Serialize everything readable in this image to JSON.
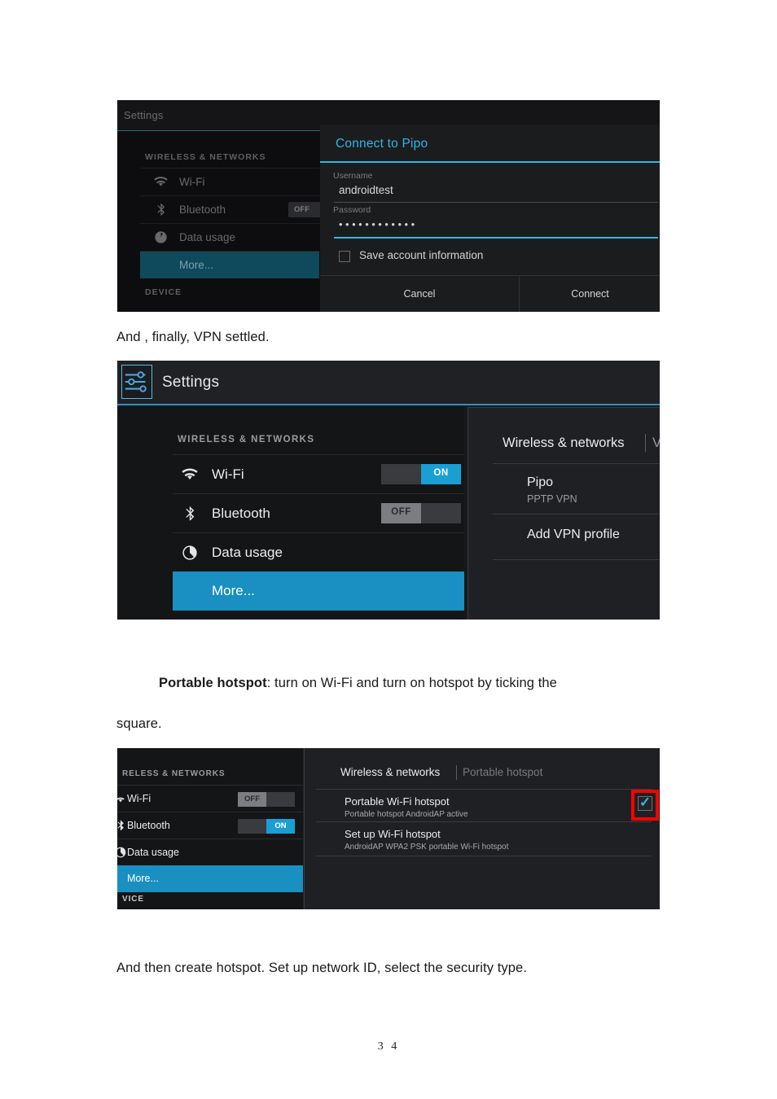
{
  "document": {
    "paragraphs": [
      {
        "id": "p1",
        "text": "And , finally, VPN settled."
      },
      {
        "id": "p2_bold",
        "text": "Portable hotspot"
      },
      {
        "id": "p2_rest",
        "text": ": turn on Wi-Fi and turn on hotspot by ticking the"
      },
      {
        "id": "p2_line2",
        "text": "square."
      },
      {
        "id": "p3",
        "text": "And then create hotspot. Set up network ID, select the security type."
      }
    ],
    "page_number": "3 4"
  },
  "shot1": {
    "title": "Settings",
    "section_label": "WIRELESS & NETWORKS",
    "rows": [
      {
        "label": "Wi-Fi",
        "icon": "wifi-icon",
        "toggle": ""
      },
      {
        "label": "Bluetooth",
        "icon": "bluetooth-icon",
        "toggle": "OFF"
      },
      {
        "label": "Data usage",
        "icon": "data-usage-icon",
        "toggle": ""
      },
      {
        "label": "More...",
        "icon": "",
        "toggle": ""
      }
    ],
    "device_label": "DEVICE",
    "dialog": {
      "title": "Connect to Pipo",
      "username_label": "Username",
      "username_value": "androidtest",
      "password_label": "Password",
      "password_value": "••••••••••••",
      "save_checkbox_label": "Save account information",
      "cancel_label": "Cancel",
      "connect_label": "Connect"
    }
  },
  "shot2": {
    "app_icon": "settings-sliders-icon",
    "title": "Settings",
    "section_label": "WIRELESS & NETWORKS",
    "rows": [
      {
        "label": "Wi-Fi",
        "icon": "wifi-icon",
        "toggle": "ON",
        "state": "on"
      },
      {
        "label": "Bluetooth",
        "icon": "bluetooth-icon",
        "toggle": "OFF",
        "state": "off"
      },
      {
        "label": "Data usage",
        "icon": "data-usage-icon",
        "toggle": "",
        "state": "none"
      },
      {
        "label": "More...",
        "icon": "",
        "toggle": "",
        "state": "none"
      }
    ],
    "breadcrumb": "Wireless & networks",
    "breadcrumb_current": "VPN",
    "items": [
      {
        "title": "Pipo",
        "subtitle": "PPTP VPN"
      },
      {
        "title": "Add VPN profile",
        "subtitle": ""
      }
    ]
  },
  "shot3": {
    "section_label": "RELESS & NETWORKS",
    "rows": [
      {
        "label": "Wi-Fi",
        "icon": "wifi-icon",
        "toggle": "OFF",
        "state": "off"
      },
      {
        "label": "Bluetooth",
        "icon": "bluetooth-icon",
        "toggle": "ON",
        "state": "on"
      },
      {
        "label": "Data usage",
        "icon": "data-usage-icon",
        "toggle": "",
        "state": "none"
      },
      {
        "label": "More...",
        "icon": "",
        "toggle": "",
        "state": "none"
      }
    ],
    "device_label": "VICE",
    "breadcrumb": "Wireless & networks",
    "breadcrumb_current": "Portable hotspot",
    "items": [
      {
        "title": "Portable Wi-Fi hotspot",
        "subtitle": "Portable hotspot AndroidAP active"
      },
      {
        "title": "Set up Wi-Fi hotspot",
        "subtitle": "AndroidAP WPA2 PSK portable Wi-Fi hotspot"
      }
    ],
    "checkbox_checked": true,
    "highlight_color": "#ff0000",
    "check_color": "#33b5e5"
  }
}
